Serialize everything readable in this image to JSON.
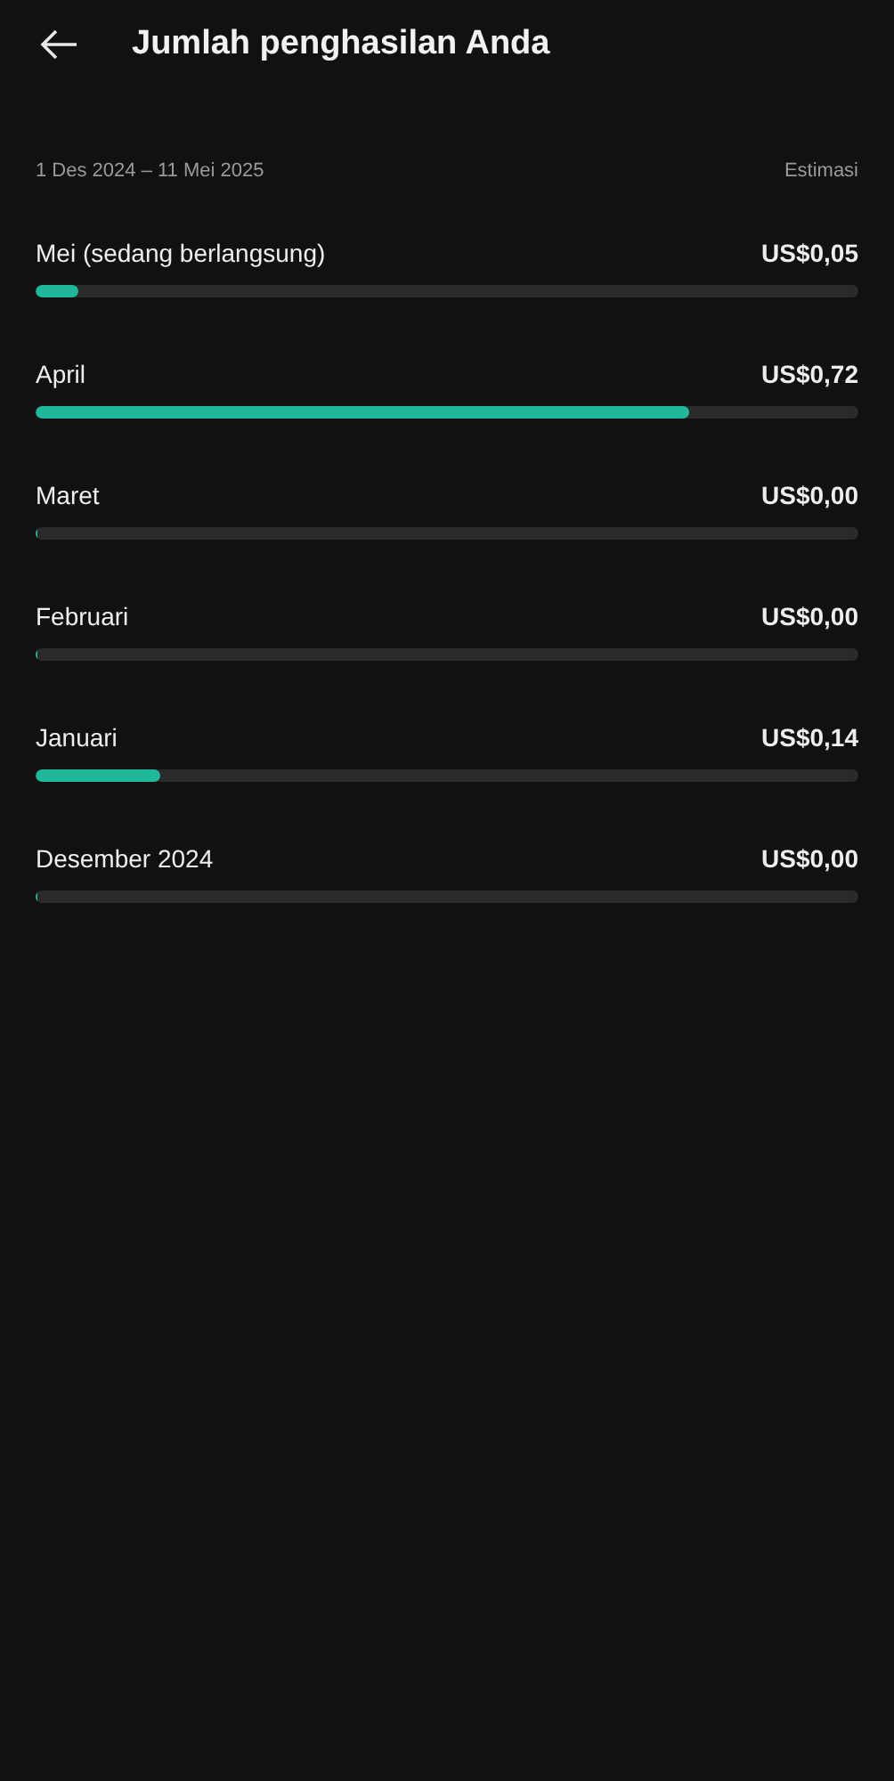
{
  "header": {
    "title": "Jumlah penghasilan Anda"
  },
  "period": {
    "range": "1 Des 2024 – 11 Mei 2025",
    "note": "Estimasi"
  },
  "months": [
    {
      "label": "Mei (sedang berlangsung)",
      "amount": "US$0,05",
      "level": 0.052
    },
    {
      "label": "April",
      "amount": "US$0,72",
      "level": 0.794
    },
    {
      "label": "Maret",
      "amount": "US$0,00",
      "level": 0
    },
    {
      "label": "Februari",
      "amount": "US$0,00",
      "level": 0
    },
    {
      "label": "Januari",
      "amount": "US$0,14",
      "level": 0.152
    },
    {
      "label": "Desember 2024",
      "amount": "US$0,00",
      "level": 0
    }
  ]
}
